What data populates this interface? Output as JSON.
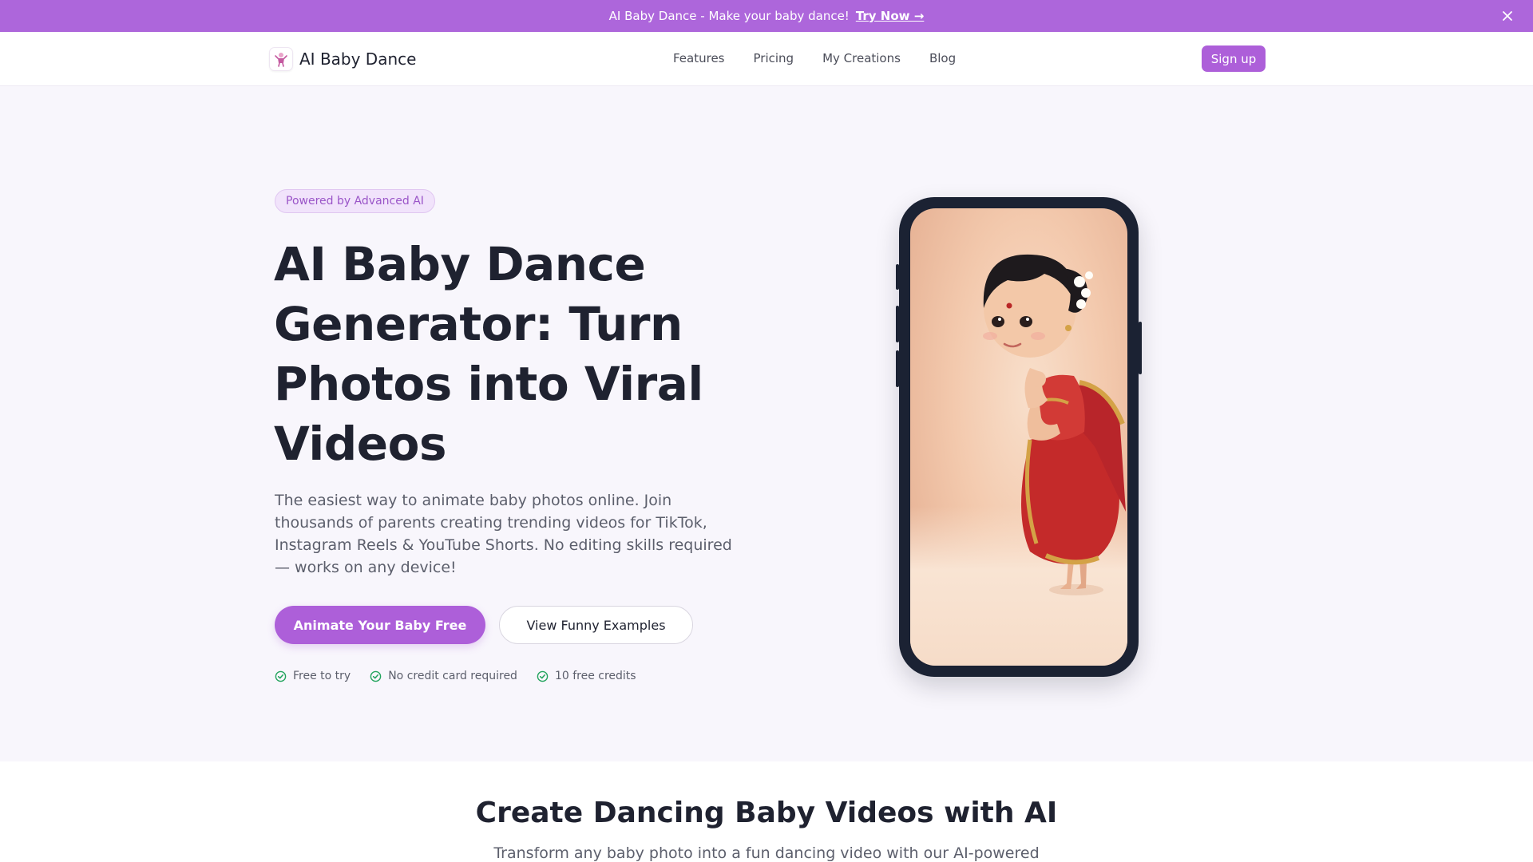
{
  "announcement": {
    "text": "AI Baby Dance - Make your baby dance!",
    "cta": "Try Now →",
    "close_icon": "close-icon"
  },
  "header": {
    "logo_text": "AI Baby Dance",
    "logo_icon": "dancing-baby-icon",
    "nav": [
      "Features",
      "Pricing",
      "My Creations",
      "Blog"
    ],
    "signup": "Sign up"
  },
  "hero": {
    "badge": "Powered by Advanced AI",
    "title": "AI Baby Dance Generator: Turn Photos into Viral Videos",
    "subtitle": "The easiest way to animate baby photos online. Join thousands of parents creating trending videos for TikTok, Instagram Reels & YouTube Shorts. No editing skills required — works on any device!",
    "primary_cta": "Animate Your Baby Free",
    "secondary_cta": "View Funny Examples",
    "checks": [
      "Free to try",
      "No credit card required",
      "10 free credits"
    ],
    "check_icon": "check-circle-icon",
    "phone_image": "dancing-baby-girl-in-saree"
  },
  "section2": {
    "title": "Create Dancing Baby Videos with AI",
    "subtitle": "Transform any baby photo into a fun dancing video with our AI-powered"
  },
  "colors": {
    "brand": "#ad5fd9",
    "announce_bg": "#ad66db",
    "hero_bg": "#f8f6fc",
    "check_green": "#22a45d",
    "phone_frame": "#1b2233"
  }
}
